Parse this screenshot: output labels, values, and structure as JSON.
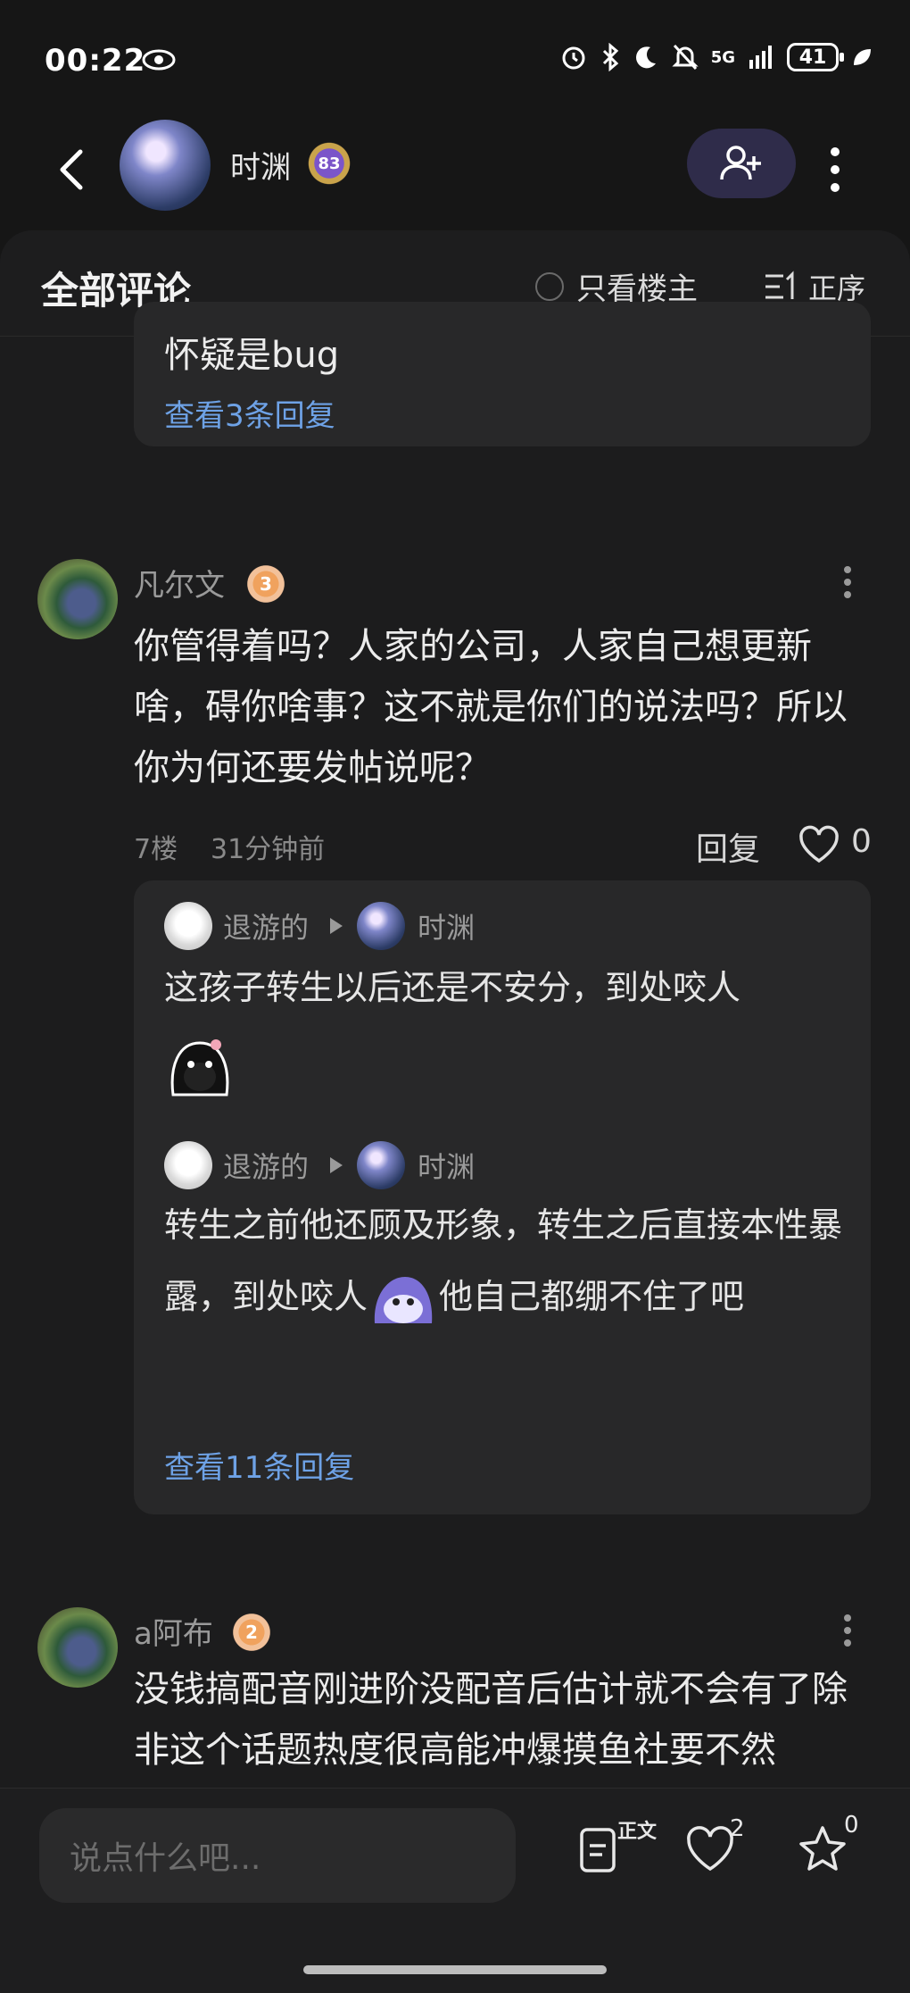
{
  "status_bar": {
    "time": "00:22",
    "battery": "41",
    "signal": "5G",
    "icons": [
      "eye-icon",
      "alarm-icon",
      "bluetooth-icon",
      "moon-icon",
      "mute-icon",
      "signal-icon",
      "leaf-icon"
    ]
  },
  "header": {
    "username": "时渊",
    "level": "83"
  },
  "comments_header": {
    "title": "全部评论",
    "only_owner": "只看楼主",
    "sort": "正序"
  },
  "previous_reply": {
    "text": "怀疑是bug",
    "view_replies": "查看3条回复"
  },
  "comment1": {
    "user": "凡尔文",
    "level": "3",
    "text": "你管得着吗？人家的公司，人家自己想更新啥，碍你啥事？这不就是你们的说法吗？所以你为何还要发帖说呢？",
    "floor": "7楼",
    "time": "31分钟前",
    "reply_label": "回复",
    "likes": "0",
    "replies": [
      {
        "from": "退游的",
        "to": "时渊",
        "text": "这孩子转生以后还是不安分，到处咬人"
      },
      {
        "from": "退游的",
        "to": "时渊",
        "text_a": "转生之前他还顾及形象，转生之后直接本性暴露，到处咬人",
        "text_b": "他自己都绷不住了吧"
      }
    ],
    "view_replies": "查看11条回复"
  },
  "comment2": {
    "user": "a阿布",
    "level": "2",
    "text": "没钱搞配音刚进阶没配音后估计就不会有了除非这个话题热度很高能冲爆摸鱼社要不然"
  },
  "bottom_bar": {
    "placeholder": "说点什么吧...",
    "body_label": "正文",
    "like_count": "2",
    "star_count": "0"
  }
}
